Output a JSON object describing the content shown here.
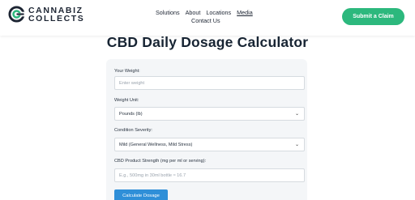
{
  "brand": {
    "line1": "CANNABIZ",
    "line2": "COLLECTS",
    "accent": "#2cb87d"
  },
  "nav": {
    "solutions": "Solutions",
    "about": "About",
    "locations": "Locations",
    "media": "Media",
    "contact": "Contact Us"
  },
  "header": {
    "cta_label": "Submit a Claim"
  },
  "page": {
    "title": "CBD Daily Dosage Calculator"
  },
  "form": {
    "weight_label": "Your Weight:",
    "weight_placeholder": "Enter weight",
    "unit_label": "Weight Unit:",
    "unit_value": "Pounds (lb)",
    "severity_label": "Condition Severity:",
    "severity_value": "Mild (General Wellness, Mild Stress)",
    "strength_label": "CBD Product Strength (mg per ml or serving):",
    "strength_placeholder": "E.g., 500mg in 30ml bottle ≈ 16.7",
    "submit_label": "Calculate Dosage"
  }
}
